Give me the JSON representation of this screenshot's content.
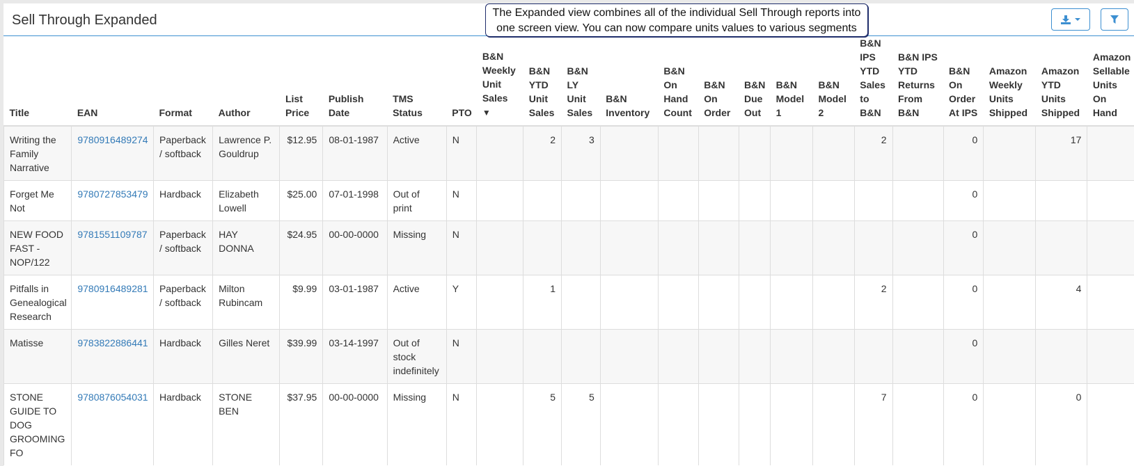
{
  "header": {
    "title": "Sell Through Expanded",
    "callout_line1": "The Expanded view combines all of the individual Sell Through reports into",
    "callout_line2": "one screen view.  You can now compare units values to various segments",
    "download_icon": "download-icon",
    "filter_icon": "filter-icon",
    "accent_color": "#3c8fd1"
  },
  "table": {
    "sort_indicator": "▼",
    "columns": [
      "Title",
      "EAN",
      "Format",
      "Author",
      "List Price",
      "Publish Date",
      "TMS Status",
      "PTO",
      "B&N Weekly Unit Sales",
      "B&N YTD Unit Sales",
      "B&N LY Unit Sales",
      "B&N Inventory",
      "B&N On Hand Count",
      "B&N On Order",
      "B&N Due Out",
      "B&N Model 1",
      "B&N Model 2",
      "B&N IPS YTD Sales to B&N",
      "B&N IPS YTD Returns From B&N",
      "B&N On Order At IPS",
      "Amazon Weekly Units Shipped",
      "Amazon YTD Units Shipped",
      "Amazon Sellable Units On Hand"
    ],
    "rows": [
      [
        "Writing the Family Narrative",
        "9780916489274",
        "Paperback / softback",
        "Lawrence P. Gouldrup",
        "$12.95",
        "08-01-1987",
        "Active",
        "N",
        "",
        "2",
        "3",
        "",
        "",
        "",
        "",
        "",
        "",
        "2",
        "",
        "0",
        "",
        "17",
        ""
      ],
      [
        "Forget Me Not",
        "9780727853479",
        "Hardback",
        "Elizabeth Lowell",
        "$25.00",
        "07-01-1998",
        "Out of print",
        "N",
        "",
        "",
        "",
        "",
        "",
        "",
        "",
        "",
        "",
        "",
        "",
        "0",
        "",
        "",
        ""
      ],
      [
        "NEW FOOD FAST -NOP/122",
        "9781551109787",
        "Paperback / softback",
        "HAY DONNA",
        "$24.95",
        "00-00-0000",
        "Missing",
        "N",
        "",
        "",
        "",
        "",
        "",
        "",
        "",
        "",
        "",
        "",
        "",
        "0",
        "",
        "",
        ""
      ],
      [
        "Pitfalls in Genealogical Research",
        "9780916489281",
        "Paperback / softback",
        "Milton Rubincam",
        "$9.99",
        "03-01-1987",
        "Active",
        "Y",
        "",
        "1",
        "",
        "",
        "",
        "",
        "",
        "",
        "",
        "2",
        "",
        "0",
        "",
        "4",
        ""
      ],
      [
        "Matisse",
        "9783822886441",
        "Hardback",
        "Gilles Neret",
        "$39.99",
        "03-14-1997",
        "Out of stock indefinitely",
        "N",
        "",
        "",
        "",
        "",
        "",
        "",
        "",
        "",
        "",
        "",
        "",
        "0",
        "",
        "",
        ""
      ],
      [
        "STONE GUIDE TO DOG GROOMING FO",
        "9780876054031",
        "Hardback",
        "STONE BEN",
        "$37.95",
        "00-00-0000",
        "Missing",
        "N",
        "",
        "5",
        "5",
        "",
        "",
        "",
        "",
        "",
        "",
        "7",
        "",
        "0",
        "",
        "0",
        ""
      ]
    ]
  }
}
